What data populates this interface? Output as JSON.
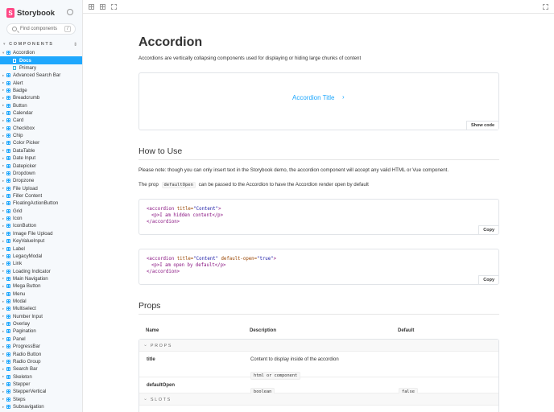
{
  "brand": {
    "logo_letter": "S",
    "name": "Storybook"
  },
  "search": {
    "placeholder": "Find components",
    "shortcut": "/"
  },
  "sidebar": {
    "section_label": "COMPONENTS",
    "items": [
      {
        "label": "Accordion",
        "expanded": true
      },
      {
        "label": "Docs",
        "sub": true,
        "selected": true
      },
      {
        "label": "Primary",
        "sub": true
      },
      {
        "label": "Advanced Search Bar"
      },
      {
        "label": "Alert"
      },
      {
        "label": "Badge"
      },
      {
        "label": "Breadcrumb"
      },
      {
        "label": "Button"
      },
      {
        "label": "Calendar"
      },
      {
        "label": "Card"
      },
      {
        "label": "Checkbox"
      },
      {
        "label": "Chip"
      },
      {
        "label": "Color Picker"
      },
      {
        "label": "DataTable"
      },
      {
        "label": "Date Input"
      },
      {
        "label": "Datepicker"
      },
      {
        "label": "Dropdown"
      },
      {
        "label": "Dropzone"
      },
      {
        "label": "File Upload"
      },
      {
        "label": "Filler Content"
      },
      {
        "label": "FloatingActionButton"
      },
      {
        "label": "Grid"
      },
      {
        "label": "Icon"
      },
      {
        "label": "IconButton"
      },
      {
        "label": "Image File Upload"
      },
      {
        "label": "KeyValueInput"
      },
      {
        "label": "Label"
      },
      {
        "label": "LegacyModal"
      },
      {
        "label": "Link"
      },
      {
        "label": "Loading Indicator"
      },
      {
        "label": "Main Navigation"
      },
      {
        "label": "Mega Button"
      },
      {
        "label": "Menu"
      },
      {
        "label": "Modal"
      },
      {
        "label": "Multiselect"
      },
      {
        "label": "Number Input"
      },
      {
        "label": "Overlay"
      },
      {
        "label": "Pagination"
      },
      {
        "label": "Panel"
      },
      {
        "label": "ProgressBar"
      },
      {
        "label": "Radio Button"
      },
      {
        "label": "Radio Group"
      },
      {
        "label": "Search Bar"
      },
      {
        "label": "Skeleton"
      },
      {
        "label": "Stepper"
      },
      {
        "label": "StepperVertical"
      },
      {
        "label": "Steps"
      },
      {
        "label": "Subnavigation"
      }
    ]
  },
  "doc": {
    "title": "Accordion",
    "subtitle": "Accordions are vertically collapsing components used for displaying or hiding large chunks of content",
    "preview": {
      "accordion_title": "Accordion Title",
      "chevron": "›",
      "show_code": "Show code"
    },
    "how_to_use": {
      "heading": "How to Use",
      "note": "Please note: though you can only insert text in the Storybook demo, the accordion component will accept any valid HTML or Vue component.",
      "prop_text_before": "The prop",
      "prop_code": "defaultOpen",
      "prop_text_after": "can be passed to the Accordion to have the Accordion render open by default"
    },
    "code1": {
      "line1_tag_open": "<accordion",
      "line1_attr": "title=",
      "line1_str": "\"Content\"",
      "line1_close": ">",
      "line2": "<p>I am hidden content</p>",
      "line3": "</accordion>",
      "copy": "Copy"
    },
    "code2": {
      "line1_tag_open": "<accordion",
      "line1_attr": "title=",
      "line1_str": "\"Content\"",
      "line1_attr2": "default-open=",
      "line1_str2": "\"true\"",
      "line1_close": ">",
      "line2": "<p>I am open by default</p>",
      "line3": "</accordion>",
      "copy": "Copy"
    },
    "props": {
      "heading": "Props",
      "columns": [
        "Name",
        "Description",
        "Default"
      ],
      "group_props": "PROPS",
      "group_slots": "SLOTS",
      "rows": [
        {
          "name": "title",
          "description": "Content to display inside of the accordion",
          "type": "html or component",
          "default": ""
        },
        {
          "name": "defaultOpen",
          "description": "",
          "type": "boolean",
          "default": "false"
        }
      ]
    }
  },
  "colors": {
    "accent": "#1ea7fd",
    "brand": "#ff4785"
  }
}
